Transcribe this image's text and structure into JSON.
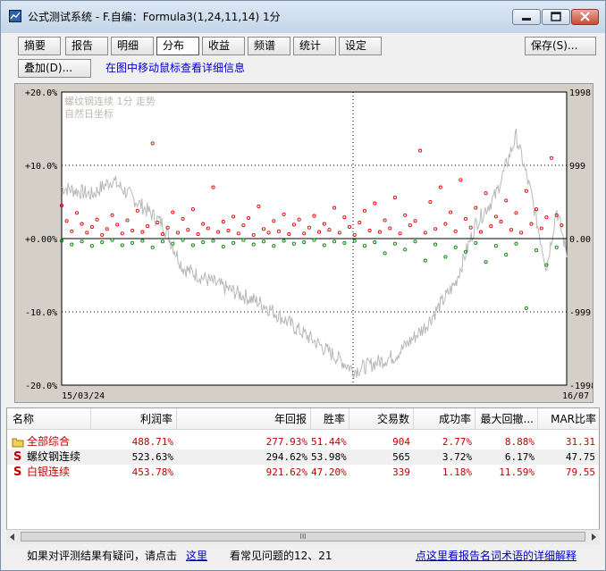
{
  "window": {
    "title": "公式测试系统 - F.自编：Formula3(1,24,11,14) 1分"
  },
  "tabs": [
    "摘要",
    "报告",
    "明细",
    "分布",
    "收益",
    "频谱",
    "统计",
    "设定"
  ],
  "active_tab": "分布",
  "toolbar": {
    "save_label": "保存(S)...",
    "overlay_label": "叠加(D)...",
    "hint": "在图中移动鼠标查看详细信息"
  },
  "chart": {
    "legend_line1": "螺纹钢连续 1分 走势",
    "legend_line2": "自然日坐标",
    "left_ticks": [
      "+20.0%",
      "+10.0%",
      "+0.00%",
      "-10.0%",
      "-20.0%"
    ],
    "right_ticks": [
      "1998",
      "999",
      "0.00",
      "-999",
      "-1998"
    ],
    "date_start": "15/03/24",
    "date_end": "16/07"
  },
  "chart_data": {
    "type": "scatter",
    "title": "螺纹钢连续 1分 走势",
    "y_left_range": [
      -20.0,
      20.0
    ],
    "y_right_range": [
      -1998,
      1998
    ],
    "x_range": [
      "15/03/24",
      "16/07"
    ],
    "series": [
      {
        "name": "profit_trades",
        "color": "#e00000",
        "points": [
          [
            0.0,
            4.5
          ],
          [
            0.01,
            2.4
          ],
          [
            0.02,
            1.0
          ],
          [
            0.03,
            3.5
          ],
          [
            0.04,
            2.0
          ],
          [
            0.05,
            0.8
          ],
          [
            0.06,
            1.6
          ],
          [
            0.07,
            2.6
          ],
          [
            0.08,
            0.5
          ],
          [
            0.09,
            1.3
          ],
          [
            0.1,
            3.2
          ],
          [
            0.11,
            1.9
          ],
          [
            0.12,
            0.7
          ],
          [
            0.13,
            2.5
          ],
          [
            0.14,
            1.1
          ],
          [
            0.15,
            3.8
          ],
          [
            0.16,
            0.9
          ],
          [
            0.17,
            1.7
          ],
          [
            0.18,
            13.0
          ],
          [
            0.19,
            2.2
          ],
          [
            0.2,
            0.6
          ],
          [
            0.21,
            1.5
          ],
          [
            0.22,
            3.6
          ],
          [
            0.23,
            0.8
          ],
          [
            0.24,
            2.7
          ],
          [
            0.25,
            1.2
          ],
          [
            0.26,
            4.0
          ],
          [
            0.27,
            0.6
          ],
          [
            0.28,
            2.0
          ],
          [
            0.29,
            1.4
          ],
          [
            0.3,
            7.0
          ],
          [
            0.31,
            0.9
          ],
          [
            0.32,
            2.3
          ],
          [
            0.33,
            1.1
          ],
          [
            0.34,
            3.0
          ],
          [
            0.35,
            0.7
          ],
          [
            0.36,
            1.8
          ],
          [
            0.37,
            2.8
          ],
          [
            0.38,
            0.5
          ],
          [
            0.39,
            4.4
          ],
          [
            0.4,
            1.3
          ],
          [
            0.41,
            0.8
          ],
          [
            0.42,
            2.4
          ],
          [
            0.43,
            1.0
          ],
          [
            0.44,
            3.3
          ],
          [
            0.45,
            0.6
          ],
          [
            0.46,
            1.9
          ],
          [
            0.47,
            2.6
          ],
          [
            0.48,
            0.7
          ],
          [
            0.49,
            1.5
          ],
          [
            0.5,
            3.1
          ],
          [
            0.51,
            0.9
          ],
          [
            0.52,
            2.0
          ],
          [
            0.53,
            1.2
          ],
          [
            0.54,
            4.2
          ],
          [
            0.55,
            0.8
          ],
          [
            0.56,
            2.9
          ],
          [
            0.57,
            1.6
          ],
          [
            0.58,
            0.5
          ],
          [
            0.59,
            2.2
          ],
          [
            0.6,
            3.8
          ],
          [
            0.61,
            1.1
          ],
          [
            0.62,
            4.8
          ],
          [
            0.63,
            0.9
          ],
          [
            0.64,
            2.5
          ],
          [
            0.65,
            1.4
          ],
          [
            0.66,
            5.6
          ],
          [
            0.67,
            0.7
          ],
          [
            0.68,
            3.2
          ],
          [
            0.69,
            1.8
          ],
          [
            0.7,
            2.4
          ],
          [
            0.71,
            12.0
          ],
          [
            0.72,
            0.8
          ],
          [
            0.73,
            5.0
          ],
          [
            0.74,
            1.3
          ],
          [
            0.75,
            7.0
          ],
          [
            0.76,
            2.0
          ],
          [
            0.77,
            3.6
          ],
          [
            0.78,
            1.0
          ],
          [
            0.79,
            8.0
          ],
          [
            0.8,
            2.7
          ],
          [
            0.81,
            1.5
          ],
          [
            0.82,
            4.2
          ],
          [
            0.83,
            0.9
          ],
          [
            0.84,
            6.2
          ],
          [
            0.85,
            1.7
          ],
          [
            0.86,
            3.0
          ],
          [
            0.87,
            2.3
          ],
          [
            0.88,
            5.2
          ],
          [
            0.89,
            1.2
          ],
          [
            0.9,
            3.5
          ],
          [
            0.91,
            0.8
          ],
          [
            0.92,
            6.5
          ],
          [
            0.93,
            2.0
          ],
          [
            0.94,
            4.0
          ],
          [
            0.95,
            1.4
          ],
          [
            0.96,
            2.9
          ],
          [
            0.97,
            11.0
          ],
          [
            0.98,
            3.2
          ],
          [
            0.99,
            1.8
          ]
        ]
      },
      {
        "name": "loss_trades",
        "color": "#008000",
        "points": [
          [
            0.0,
            -0.3
          ],
          [
            0.02,
            -0.8
          ],
          [
            0.04,
            -0.4
          ],
          [
            0.06,
            -1.0
          ],
          [
            0.08,
            -0.5
          ],
          [
            0.1,
            -0.2
          ],
          [
            0.12,
            -0.9
          ],
          [
            0.14,
            -0.6
          ],
          [
            0.16,
            -0.3
          ],
          [
            0.18,
            -1.2
          ],
          [
            0.2,
            -0.4
          ],
          [
            0.22,
            -0.7
          ],
          [
            0.24,
            -0.2
          ],
          [
            0.26,
            -0.9
          ],
          [
            0.28,
            -0.5
          ],
          [
            0.3,
            -0.3
          ],
          [
            0.32,
            -1.1
          ],
          [
            0.34,
            -0.6
          ],
          [
            0.36,
            -0.2
          ],
          [
            0.38,
            -0.8
          ],
          [
            0.4,
            -0.4
          ],
          [
            0.42,
            -1.0
          ],
          [
            0.44,
            -0.3
          ],
          [
            0.46,
            -0.7
          ],
          [
            0.48,
            -0.5
          ],
          [
            0.5,
            -0.2
          ],
          [
            0.52,
            -0.9
          ],
          [
            0.54,
            -0.4
          ],
          [
            0.56,
            -0.6
          ],
          [
            0.58,
            -0.3
          ],
          [
            0.6,
            -1.0
          ],
          [
            0.62,
            -0.5
          ],
          [
            0.64,
            -2.0
          ],
          [
            0.66,
            -0.7
          ],
          [
            0.68,
            -1.5
          ],
          [
            0.7,
            -0.4
          ],
          [
            0.72,
            -3.0
          ],
          [
            0.74,
            -0.8
          ],
          [
            0.76,
            -2.5
          ],
          [
            0.78,
            -1.2
          ],
          [
            0.8,
            -1.8
          ],
          [
            0.82,
            -0.6
          ],
          [
            0.84,
            -3.2
          ],
          [
            0.86,
            -1.0
          ],
          [
            0.88,
            -2.2
          ],
          [
            0.9,
            -0.7
          ],
          [
            0.92,
            -9.5
          ],
          [
            0.94,
            -1.6
          ],
          [
            0.96,
            -3.6
          ],
          [
            0.98,
            -1.2
          ]
        ]
      }
    ],
    "price_line_color": "#b8b8b8"
  },
  "table": {
    "headers": [
      "名称",
      "利润率",
      "年回报",
      "胜率",
      "交易数",
      "成功率",
      "最大回撤...",
      "MAR比率"
    ],
    "rows": [
      {
        "icon": "folder-icon",
        "name": "全部综合",
        "values": [
          "488.71%",
          "277.93%",
          "51.44%",
          "904",
          "2.77%",
          "8.88%",
          "31.31"
        ]
      },
      {
        "icon": "s-icon",
        "name": "螺纹钢连续",
        "values": [
          "523.63%",
          "294.62%",
          "53.98%",
          "565",
          "3.72%",
          "6.17%",
          "47.75"
        ]
      },
      {
        "icon": "s-icon",
        "name": "白银连续",
        "values": [
          "453.78%",
          "921.62%",
          "47.20%",
          "339",
          "1.18%",
          "11.59%",
          "79.55"
        ]
      }
    ],
    "scroll_label": "III"
  },
  "footer": {
    "question_prefix": "如果对评测结果有疑问，请点击",
    "here_link": "这里",
    "faq_text": "看常见问题的12、21",
    "glossary_link": "点这里看报告名词术语的详细解释"
  },
  "colors": {
    "profit": "#e00000",
    "loss": "#008000",
    "link": "#0000c8"
  }
}
